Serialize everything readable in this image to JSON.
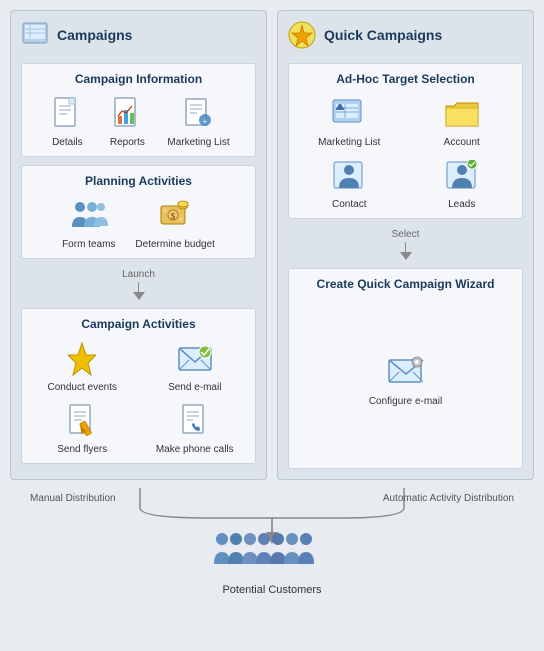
{
  "left": {
    "title": "Campaigns",
    "sections": {
      "info": {
        "title": "Campaign Information",
        "items": [
          {
            "label": "Details",
            "icon": "document"
          },
          {
            "label": "Reports",
            "icon": "chart"
          },
          {
            "label": "Marketing List",
            "icon": "list"
          }
        ]
      },
      "planning": {
        "title": "Planning Activities",
        "items": [
          {
            "label": "Form teams",
            "icon": "team"
          },
          {
            "label": "Determine budget",
            "icon": "budget"
          }
        ]
      },
      "campaign_arrow": "Launch",
      "activities": {
        "title": "Campaign Activities",
        "items": [
          {
            "label": "Conduct events",
            "icon": "lightning"
          },
          {
            "label": "Send e-mail",
            "icon": "email"
          },
          {
            "label": "Send flyers",
            "icon": "flyer"
          },
          {
            "label": "Make phone calls",
            "icon": "phone"
          }
        ]
      }
    }
  },
  "right": {
    "title": "Quick Campaigns",
    "sections": {
      "adhoc": {
        "title": "Ad-Hoc Target Selection",
        "items": [
          {
            "label": "Marketing List",
            "icon": "mktlist"
          },
          {
            "label": "Account",
            "icon": "account"
          },
          {
            "label": "Contact",
            "icon": "contact"
          },
          {
            "label": "Leads",
            "icon": "leads"
          }
        ]
      },
      "select_arrow": "Select",
      "wizard": {
        "title": "Create Quick Campaign Wizard",
        "items": [
          {
            "label": "Configure e-mail",
            "icon": "config"
          }
        ]
      }
    }
  },
  "bottom": {
    "left_label": "Manual Distribution",
    "right_label": "Automatic Activity Distribution",
    "customers_label": "Potential Customers"
  }
}
